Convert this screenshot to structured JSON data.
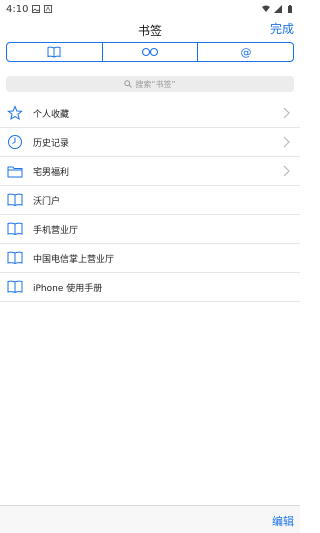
{
  "status": {
    "time": "4:10"
  },
  "nav": {
    "title": "书签",
    "done_label": "完成"
  },
  "segments": [
    {
      "icon": "book-icon"
    },
    {
      "icon": "glasses-icon"
    },
    {
      "icon": "at-icon"
    }
  ],
  "search": {
    "placeholder": "搜索“书签”"
  },
  "items": [
    {
      "label": "个人收藏",
      "icon": "star-icon",
      "chevron": true
    },
    {
      "label": "历史记录",
      "icon": "clock-icon",
      "chevron": true
    },
    {
      "label": "宅男福利",
      "icon": "folder-icon",
      "chevron": true
    },
    {
      "label": "沃门户",
      "icon": "book-icon",
      "chevron": false
    },
    {
      "label": "手机营业厅",
      "icon": "book-icon",
      "chevron": false
    },
    {
      "label": "中国电信掌上营业厅",
      "icon": "book-icon",
      "chevron": false
    },
    {
      "label": "iPhone 使用手册",
      "icon": "book-icon",
      "chevron": false
    }
  ],
  "bottom": {
    "edit_label": "编辑"
  },
  "colors": {
    "accent": "#1a73e8",
    "separator": "#e6e6e6",
    "search_bg": "#ececec"
  }
}
